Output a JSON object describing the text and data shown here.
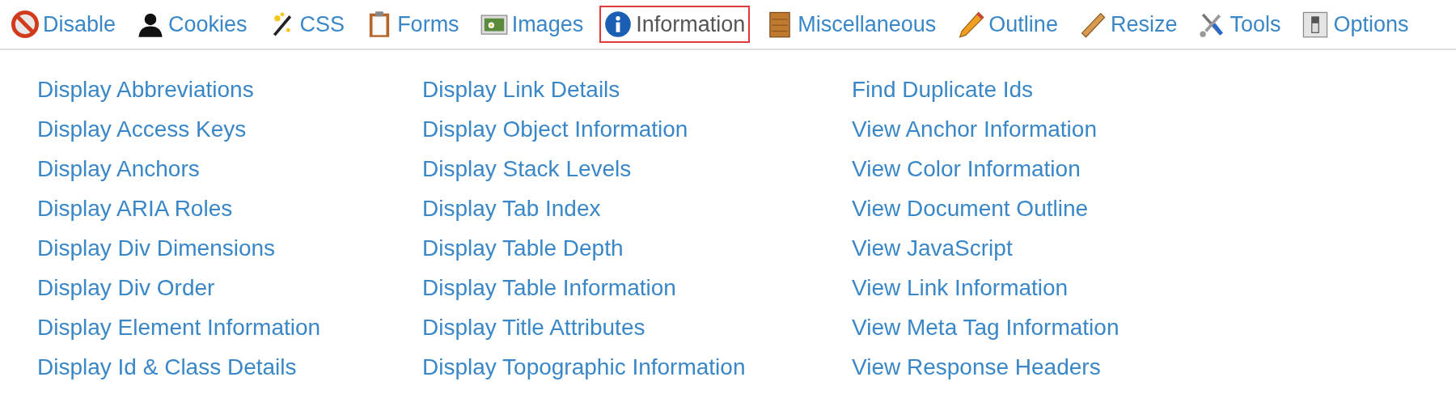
{
  "tabs": [
    {
      "label": "Disable",
      "selected": false
    },
    {
      "label": "Cookies",
      "selected": false
    },
    {
      "label": "CSS",
      "selected": false
    },
    {
      "label": "Forms",
      "selected": false
    },
    {
      "label": "Images",
      "selected": false
    },
    {
      "label": "Information",
      "selected": true
    },
    {
      "label": "Miscellaneous",
      "selected": false
    },
    {
      "label": "Outline",
      "selected": false
    },
    {
      "label": "Resize",
      "selected": false
    },
    {
      "label": "Tools",
      "selected": false
    },
    {
      "label": "Options",
      "selected": false
    }
  ],
  "menu_columns": [
    [
      "Display Abbreviations",
      "Display Access Keys",
      "Display Anchors",
      "Display ARIA Roles",
      "Display Div Dimensions",
      "Display Div Order",
      "Display Element Information",
      "Display Id & Class Details"
    ],
    [
      "Display Link Details",
      "Display Object Information",
      "Display Stack Levels",
      "Display Tab Index",
      "Display Table Depth",
      "Display Table Information",
      "Display Title Attributes",
      "Display Topographic Information"
    ],
    [
      "Find Duplicate Ids",
      "View Anchor Information",
      "View Color Information",
      "View Document Outline",
      "View JavaScript",
      "View Link Information",
      "View Meta Tag Information",
      "View Response Headers"
    ]
  ]
}
